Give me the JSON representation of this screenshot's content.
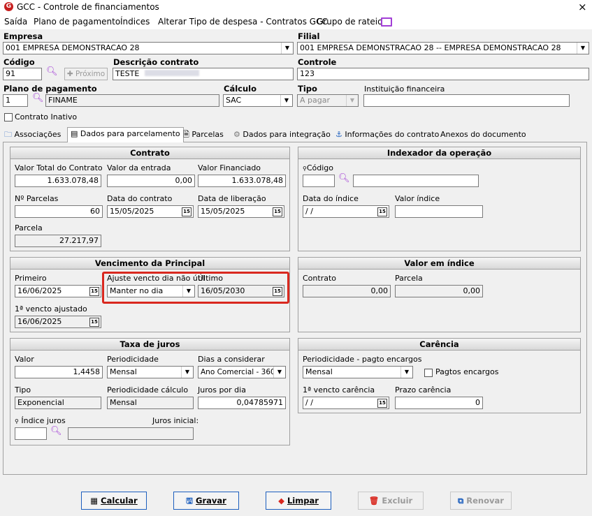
{
  "window": {
    "title": "GCC - Controle de financiamentos",
    "close": "×"
  },
  "menu": [
    "Saída",
    "Plano de pagamento",
    "Índices",
    "Alterar Tipo de despesa - Contratos GCC",
    "Grupo de rateio"
  ],
  "header": {
    "empresa_label": "Empresa",
    "empresa_value": "001 EMPRESA DEMONSTRACAO 28",
    "filial_label": "Filial",
    "filial_value": "001 EMPRESA DEMONSTRACAO 28 -- EMPRESA DEMONSTRACAO 28",
    "codigo_label": "Código",
    "codigo_value": "91",
    "proximo_label": "Próximo",
    "descricao_label": "Descrição contrato",
    "descricao_value": "TESTE",
    "controle_label": "Controle",
    "controle_value": "123",
    "plano_label": "Plano de pagamento",
    "plano_code": "1",
    "plano_name": "FINAME",
    "calculo_label": "Cálculo",
    "calculo_value": "SAC",
    "tipo_label": "Tipo",
    "tipo_value": "A pagar",
    "instituicao_label": "Instituição financeira",
    "instituicao_value": "",
    "contrato_inativo": "Contrato Inativo"
  },
  "tabs": [
    "Associações",
    "Dados para parcelamento",
    "Parcelas",
    "Dados para integração",
    "Informações do contrato",
    "Anexos do documento"
  ],
  "contrato": {
    "title": "Contrato",
    "valor_total_label": "Valor Total do Contrato",
    "valor_total": "1.633.078,48",
    "valor_entrada_label": "Valor da entrada",
    "valor_entrada": "0,00",
    "valor_financiado_label": "Valor Financiado",
    "valor_financiado": "1.633.078,48",
    "n_parcelas_label": "Nº Parcelas",
    "n_parcelas": "60",
    "data_contrato_label": "Data do contrato",
    "data_contrato": "15/05/2025",
    "data_liberacao_label": "Data de liberação",
    "data_liberacao": "15/05/2025",
    "parcela_label": "Parcela",
    "parcela": "27.217,97"
  },
  "indexador": {
    "title": "Indexador da operação",
    "codigo_label": "Código",
    "codigo": "",
    "nome": "",
    "data_indice_label": "Data do índice",
    "data_indice": " / /",
    "valor_indice_label": "Valor índice",
    "valor_indice": ""
  },
  "vencimento": {
    "title": "Vencimento da Principal",
    "primeiro_label": "Primeiro",
    "primeiro": "16/06/2025",
    "ajuste_label": "Ajuste vencto dia não útil",
    "ajuste": "Manter no dia",
    "ultimo_label": "Último",
    "ultimo": "16/05/2030",
    "ajustado_label": "1ª vencto ajustado",
    "ajustado": "16/06/2025"
  },
  "valor_indice": {
    "title": "Valor em índice",
    "contrato_label": "Contrato",
    "contrato": "0,00",
    "parcela_label": "Parcela",
    "parcela": "0,00"
  },
  "juros": {
    "title": "Taxa de juros",
    "valor_label": "Valor",
    "valor": "1,4458",
    "periodicidade_label": "Periodicidade",
    "periodicidade": "Mensal",
    "dias_label": "Dias a considerar",
    "dias": "Ano Comercial - 360",
    "tipo_label": "Tipo",
    "tipo": "Exponencial",
    "period_calc_label": "Periodicidade cálculo",
    "period_calc": "Mensal",
    "juros_dia_label": "Juros por dia",
    "juros_dia": "0,04785971",
    "indice_label": "Índice juros",
    "juros_inicial_label": "Juros inicial:"
  },
  "carencia": {
    "title": "Carência",
    "period_label": "Periodicidade - pagto encargos",
    "period": "Mensal",
    "pagtos_label": "Pagtos encargos",
    "venc_label": "1ª vencto carência",
    "venc": " / /",
    "prazo_label": "Prazo carência",
    "prazo": "0"
  },
  "buttons": {
    "calcular": "Calcular",
    "gravar": "Gravar",
    "limpar": "Limpar",
    "excluir": "Excluir",
    "renovar": "Renovar"
  },
  "colors": {
    "accent": "#1d5fbe",
    "highlight": "#d9281f",
    "search": "#a23fd6"
  }
}
